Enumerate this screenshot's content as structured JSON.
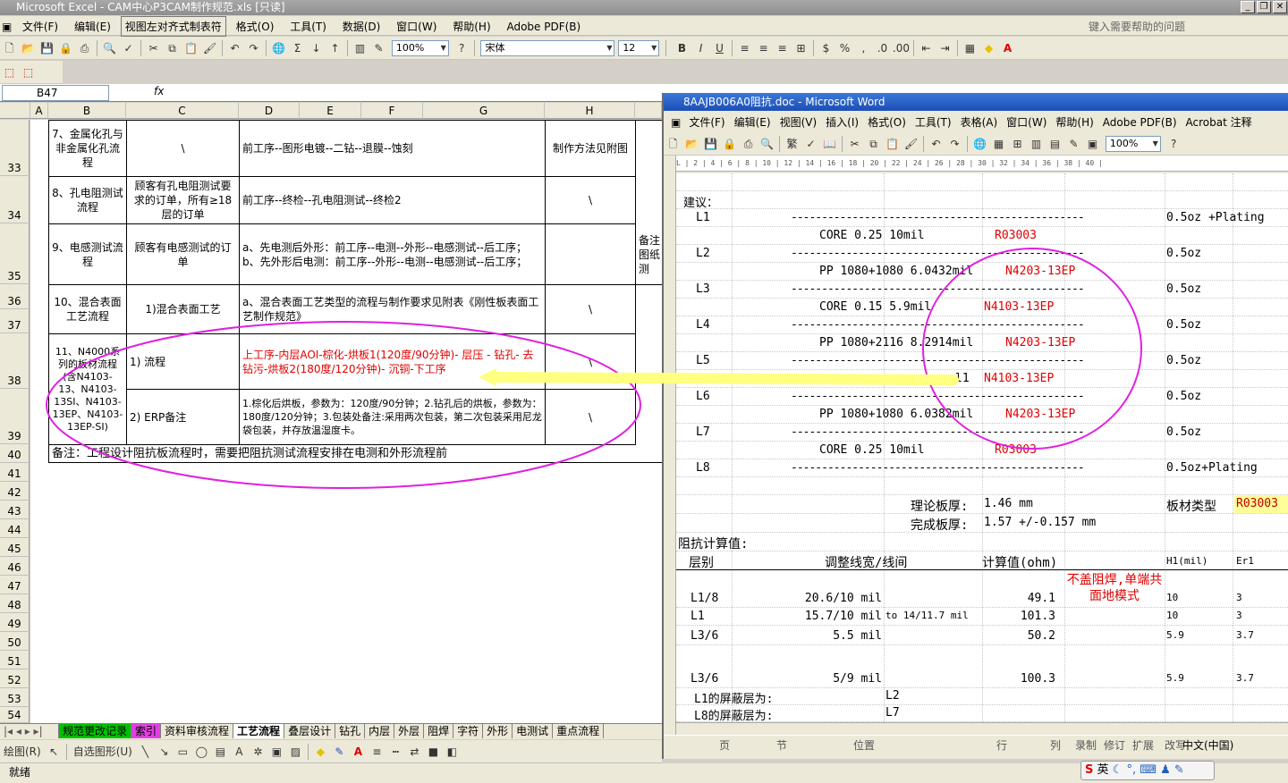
{
  "excel": {
    "title": "Microsoft Excel - CAM中心P3CAM制作规范.xls [只读]",
    "menu": [
      "文件(F)",
      "编辑(E)",
      "视图左对齐式制表符",
      "格式(O)",
      "工具(T)",
      "数据(D)",
      "窗口(W)",
      "帮助(H)",
      "Adobe PDF(B)"
    ],
    "help_placeholder": "键入需要帮助的问题",
    "zoom": "100%",
    "font": "宋体",
    "font_size": "12",
    "name_box": "B47",
    "fx": "fx",
    "columns": [
      "A",
      "B",
      "C",
      "D",
      "E",
      "F",
      "G",
      "H"
    ],
    "rows": [
      "33",
      "34",
      "35",
      "36",
      "37",
      "38",
      "39",
      "40",
      "41",
      "42",
      "43",
      "44",
      "45",
      "46",
      "47",
      "48",
      "49",
      "50",
      "51",
      "52",
      "53",
      "54"
    ],
    "table": {
      "r33_b": "7、金属化孔与非金属化孔流程",
      "r33_c": "\\",
      "r33_d": "前工序--图形电镀--二钻--退膜--蚀刻",
      "r33_h": "制作方法见附图",
      "r34_b": "8、孔电阻测试流程",
      "r34_c": "顾客有孔电阻测试要求的订单，所有≥18层的订单",
      "r34_d": "前工序--终检--孔电阻测试--终检2",
      "r34_h": "\\",
      "r35_b": "9、电感测试流程",
      "r35_c": "顾客有电感测试的订单",
      "r35_d": "a、先电测后外形：前工序--电测--外形--电感测试--后工序；\nb、先外形后电测：前工序--外形--电测--电感测试--后工序；",
      "r35_i": "备注图纸测",
      "r36_b": "10、混合表面工艺流程",
      "r36_c": "1)混合表面工艺",
      "r36_d": "a、混合表面工艺类型的流程与制作要求见附表《刚性板表面工艺制作规范》",
      "r36_h": "\\",
      "r38_b": "11、N4000系列的板材流程(含N4103-13、N4103-13SI、N4103-13EP、N4103-13EP-SI)",
      "r38_c": "1) 流程",
      "r38_d": "上工序-内层AOI-棕化-烘板1(120度/90分钟)- 层压 - 钻孔- 去钻污-烘板2(180度/120分钟)- 沉铜-下工序",
      "r38_h": "\\",
      "r39_c": "2) ERP备注",
      "r39_d": "1.棕化后烘板，参数为：120度/90分钟；2.钻孔后的烘板，参数为：180度/120分钟；3.包装处备注:采用两次包装，第二次包装采用尼龙袋包装，并存放温湿度卡。",
      "r39_h": "\\",
      "r40": "备注：工程设计阻抗板流程时，需要把阻抗测试流程安排在电测和外形流程前"
    },
    "sheet_tabs": [
      "规范更改记录",
      "索引",
      "资料审核流程",
      "工艺流程",
      "叠层设计",
      "钻孔",
      "内层",
      "外层",
      "阻焊",
      "字符",
      "外形",
      "电测试",
      "重点流程"
    ],
    "draw_label": "绘图(R)",
    "autoshape_label": "自选图形(U)",
    "status": "就绪"
  },
  "word": {
    "title": "8AAJB006A0阻抗.doc - Microsoft Word",
    "menu": [
      "文件(F)",
      "编辑(E)",
      "视图(V)",
      "插入(I)",
      "格式(O)",
      "工具(T)",
      "表格(A)",
      "窗口(W)",
      "帮助(H)",
      "Adobe PDF(B)",
      "Acrobat 注释"
    ],
    "zoom": "100%",
    "ruler": "L  | 2 |  4 |  6 |  8 | 10 | 12 | 14 | 16 | 18 | 20 | 22 | 24 | 26 | 28 | 30 | 32 | 34 | 36 | 38 | 40 |",
    "jianyi": "建议：",
    "stack": [
      {
        "layer": "L1",
        "dash": "------------------------------------------------",
        "cu": "0.5oz +Plating"
      },
      {
        "mid": "CORE  0.25  10mil",
        "mat": "R03003"
      },
      {
        "layer": "L2",
        "dash": "------------------------------------------------",
        "cu": "0.5oz"
      },
      {
        "mid": "PP  1080+1080  6.0432mil",
        "mat": "N4203-13EP"
      },
      {
        "layer": "L3",
        "dash": "------------------------------------------------",
        "cu": "0.5oz"
      },
      {
        "mid": "CORE  0.15  5.9mil",
        "mat": "N4103-13EP"
      },
      {
        "layer": "L4",
        "dash": "------------------------------------------------",
        "cu": "0.5oz"
      },
      {
        "mid": "PP  1080+2116  8.2914mil",
        "mat": "N4203-13EP"
      },
      {
        "layer": "L5",
        "dash": "------------------------------------------------",
        "cu": "0.5oz"
      },
      {
        "mid": "l1",
        "mat": "N4103-13EP"
      },
      {
        "layer": "L6",
        "dash": "------------------------------------------------",
        "cu": "0.5oz"
      },
      {
        "mid": "PP  1080+1080  6.0382mil",
        "mat": "N4203-13EP"
      },
      {
        "layer": "L7",
        "dash": "------------------------------------------------",
        "cu": "0.5oz"
      },
      {
        "mid": "CORE  0.25  10mil",
        "mat": "R03003"
      },
      {
        "layer": "L8",
        "dash": "------------------------------------------------",
        "cu": "0.5oz+Plating"
      }
    ],
    "theory_label": "理论板厚:",
    "theory_val": "1.46 mm",
    "material_label": "板材类型",
    "material_val": "R03003",
    "finish_label": "完成板厚:",
    "finish_val": "1.57 +/-0.157 mm",
    "calc_title": "阻抗计算值:",
    "hdr_layer": "层别",
    "hdr_width": "调整线宽/线间",
    "hdr_calc": "计算值(ohm)",
    "hdr_h1": "H1(mil)",
    "hdr_er": "Er1",
    "note": "不盖阻焊,单端共面地模式",
    "imp": [
      {
        "layer": "L1/8",
        "width": "20.6/10 mil",
        "extra": "",
        "calc": "49.1",
        "h1": "10",
        "er": "3"
      },
      {
        "layer": "L1",
        "width": "15.7/10 mil",
        "extra": "to 14/11.7 mil",
        "calc": "101.3",
        "h1": "10",
        "er": "3"
      },
      {
        "layer": "L3/6",
        "width": "5.5 mil",
        "extra": "",
        "calc": "50.2",
        "h1": "5.9",
        "er": "3.7"
      },
      {
        "layer": "L3/6",
        "width": "5/9 mil",
        "extra": "",
        "calc": "100.3",
        "h1": "5.9",
        "er": "3.7"
      }
    ],
    "shield1": "L1的屏蔽层为:",
    "shield1v": "L2",
    "shield2": "L8的屏蔽层为:",
    "shield2v": "L7",
    "status": [
      "页",
      "节",
      "位置",
      "行",
      "列",
      "录制",
      "修订",
      "扩展",
      "改写",
      "中文(中国)"
    ]
  },
  "ime": "英"
}
